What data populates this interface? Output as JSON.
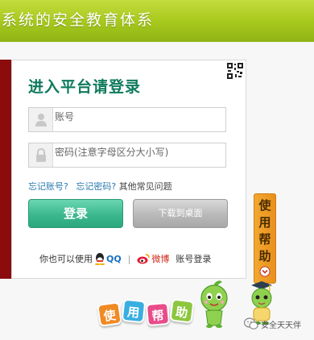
{
  "header": {
    "title": "系统的安全教育体系"
  },
  "login": {
    "title": "进入平台请登录",
    "username": {
      "value": "",
      "placeholder": "账号"
    },
    "password": {
      "value": "",
      "placeholder": "密码(注意字母区分大小写)"
    },
    "forgot_account": "忘记账号?",
    "forgot_password": "忘记密码?",
    "other_issues": "其他常见问题",
    "login_button": "登录",
    "download_button": "下载到桌面",
    "social_prefix": "你也可以使用",
    "qq_label": "QQ",
    "separator": "|",
    "weibo_label": "微博",
    "social_suffix": "账号登录"
  },
  "help_tab": {
    "chars": [
      "使",
      "用",
      "帮",
      "助"
    ]
  },
  "help_banner": {
    "chars": [
      "使",
      "用",
      "帮",
      "助"
    ]
  },
  "footer": {
    "label": "安全天天伴"
  },
  "colors": {
    "header_green": "#a8c91e",
    "title_green": "#0e7a5c",
    "login_button": "#3cb88e",
    "download_button": "#b9b9b9",
    "link_blue": "#2a7ab0",
    "help_orange": "#e8901c",
    "left_strip": "#8a0c0c"
  },
  "icons": [
    "qr-code-icon",
    "user-icon",
    "lock-icon",
    "qq-icon",
    "weibo-icon",
    "chevron-down-icon",
    "wechat-icon"
  ]
}
